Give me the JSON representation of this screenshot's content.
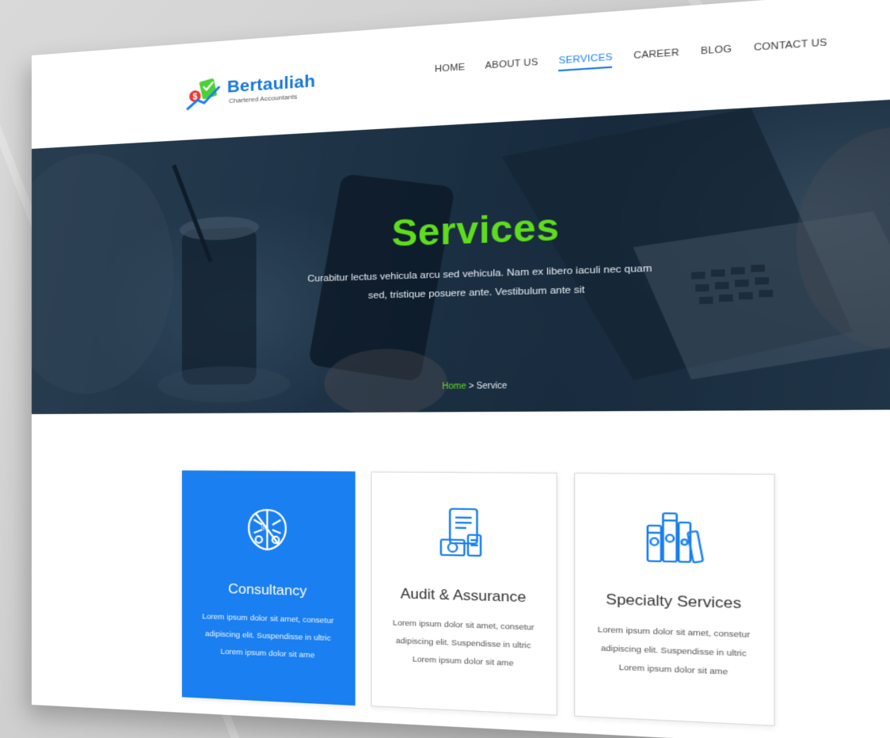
{
  "header": {
    "logo": {
      "name": "Bertauliah",
      "tagline": "Chartered Accountants",
      "icon": "chart-check-icon"
    },
    "nav": [
      {
        "label": "HOME",
        "active": false
      },
      {
        "label": "ABOUT US",
        "active": false
      },
      {
        "label": "SERVICES",
        "active": true
      },
      {
        "label": "CAREER",
        "active": false
      },
      {
        "label": "BLOG",
        "active": false
      },
      {
        "label": "CONTACT US",
        "active": false
      }
    ]
  },
  "hero": {
    "title": "Services",
    "subtitle": "Curabitur lectus vehicula arcu sed vehicula. Nam ex libero iaculi nec quam sed, tristique posuere ante. Vestibulum ante sit",
    "breadcrumb": {
      "home": "Home",
      "separator": " > ",
      "current": "Service"
    }
  },
  "services": {
    "cards": [
      {
        "icon": "consultancy-brain-icon",
        "title": "Consultancy",
        "desc": "Lorem ipsum dolor sit amet, consetur adipiscing elit. Suspendisse in ultric Lorem ipsum dolor sit ame",
        "featured": true
      },
      {
        "icon": "audit-document-icon",
        "title": "Audit & Assurance",
        "desc": "Lorem ipsum dolor sit amet, consetur adipiscing elit. Suspendisse in ultric Lorem ipsum dolor sit ame",
        "featured": false
      },
      {
        "icon": "specialty-books-icon",
        "title": "Specialty Services",
        "desc": "Lorem ipsum dolor sit amet, consetur adipiscing elit. Suspendisse in ultric Lorem ipsum dolor sit ame",
        "featured": false
      }
    ]
  },
  "colors": {
    "brand_blue": "#1a7ff0",
    "hero_title_green": "#5fdc1e",
    "hero_overlay": "#102134"
  }
}
